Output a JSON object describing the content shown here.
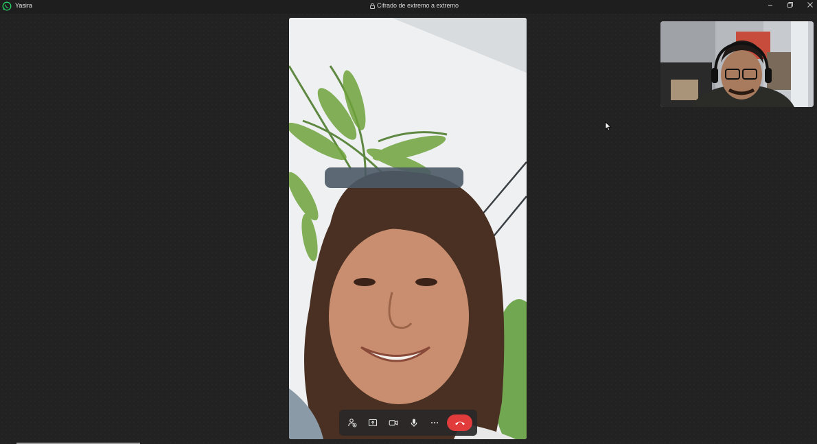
{
  "titlebar": {
    "contact_name": "Yasira",
    "encryption_text": "Cifrado de extremo a extremo",
    "app_icon": "whatsapp-icon",
    "controls": [
      "minimize-icon",
      "restore-icon",
      "close-icon"
    ]
  },
  "call_controls": {
    "buttons": [
      "add-participant-icon",
      "screen-share-icon",
      "camera-icon",
      "microphone-icon",
      "more-options-icon",
      "end-call-icon"
    ]
  },
  "colors": {
    "background": "#222222",
    "titlebar": "#1e1e1e",
    "end_call": "#e23b3b",
    "whatsapp_green": "#25d366"
  }
}
